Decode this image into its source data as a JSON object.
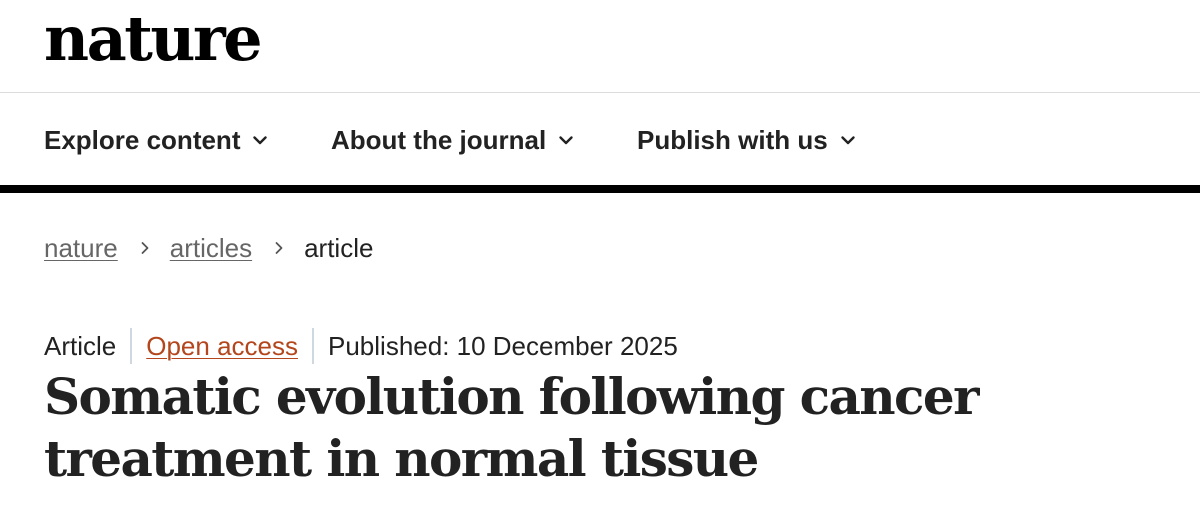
{
  "header": {
    "logo_text": "nature"
  },
  "nav": {
    "items": [
      {
        "label": "Explore content",
        "icon": "chevron-down-icon"
      },
      {
        "label": "About the journal",
        "icon": "chevron-down-icon"
      },
      {
        "label": "Publish with us",
        "icon": "chevron-down-icon"
      }
    ]
  },
  "breadcrumb": {
    "items": [
      "nature",
      "articles",
      "article"
    ],
    "separator_icon": "chevron-right-icon"
  },
  "article": {
    "type": "Article",
    "access": "Open access",
    "published": "Published: 10 December 2025",
    "title": "Somatic evolution following cancer treatment in normal tissue"
  },
  "colors": {
    "text": "#222222",
    "logo": "#000000",
    "breadcrumb_link": "#666666",
    "open_access": "#b3461c",
    "nav_rule": "#000000",
    "meta_divider": "#cfd8e0"
  }
}
